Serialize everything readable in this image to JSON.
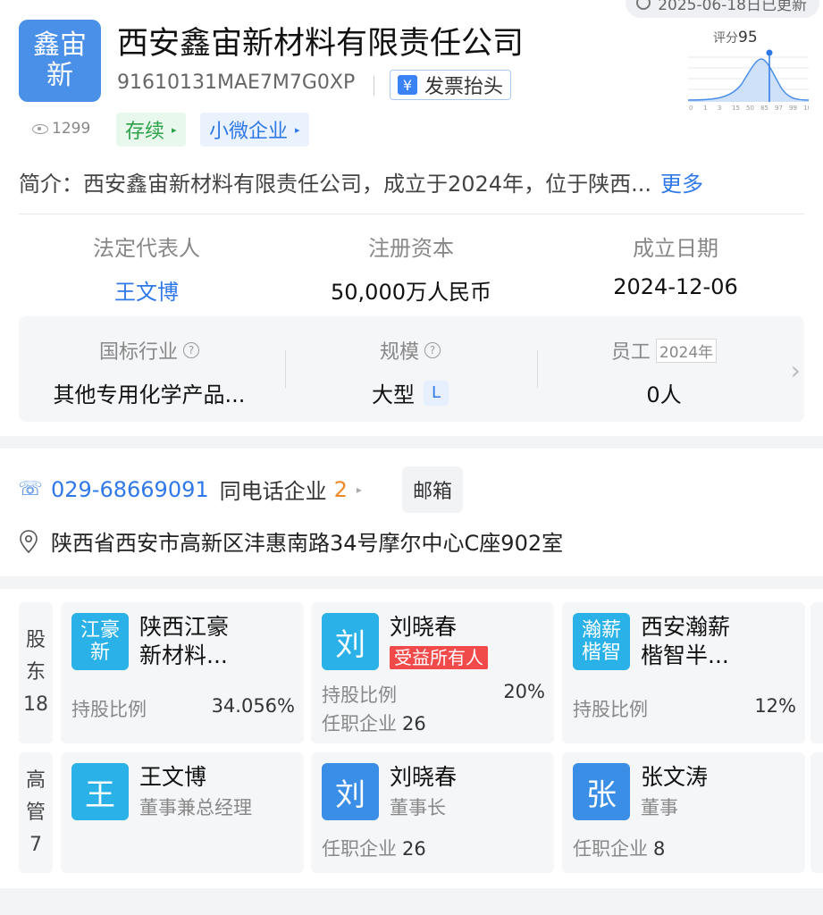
{
  "status": {
    "update_text": "2025-06-18日已更新"
  },
  "company": {
    "logo_lines": [
      "鑫宙",
      "新"
    ],
    "name": "西安鑫宙新材料有限责任公司",
    "credit_code": "91610131MAE7M7G0XP",
    "invoice_label": "发票抬头",
    "invoice_icon_glyph": "¥",
    "views": "1299",
    "tags": [
      {
        "label": "存续",
        "color": "#2ca14a"
      },
      {
        "label": "小微企业",
        "color": "#2f78e8"
      }
    ],
    "intro_prefix": "简介：",
    "intro_text": "西安鑫宙新材料有限责任公司，成立于2024年，位于陕西...",
    "intro_more": "更多"
  },
  "score": {
    "label": "评分",
    "value": "95",
    "ticks": [
      "0",
      "1",
      "3",
      "15",
      "50",
      "85",
      "97",
      "99",
      "100"
    ]
  },
  "key_info": [
    {
      "label": "法定代表人",
      "value": "王文博",
      "link": true
    },
    {
      "label": "注册资本",
      "value": "50,000万人民币",
      "link": false
    },
    {
      "label": "成立日期",
      "value": "2024-12-06",
      "link": false
    }
  ],
  "info_panel": {
    "industry": {
      "label": "国标行业",
      "value": "其他专用化学产品..."
    },
    "scale": {
      "label": "规模",
      "value": "大型",
      "badge": "L"
    },
    "staff": {
      "label": "员工",
      "year": "2024年",
      "value": "0人"
    }
  },
  "contact": {
    "phone": "029-68669091",
    "same_phone_label": "同电话企业",
    "same_phone_count": "2",
    "email_label": "邮箱",
    "address": "陕西省西安市高新区沣惠南路34号摩尔中心C座902室"
  },
  "shareholders": {
    "side_label": [
      "股",
      "东",
      "18"
    ],
    "items": [
      {
        "avatar_lines": [
          "江豪",
          "新"
        ],
        "avatar_color": "#29b1e8",
        "name_lines": [
          "陕西江豪",
          "新材料..."
        ],
        "ratio_label": "持股比例",
        "ratio": "34.056%"
      },
      {
        "avatar_lines": [
          "刘"
        ],
        "avatar_color": "#29b1e8",
        "name_lines": [
          "刘晓春"
        ],
        "badge": "受益所有人",
        "ratio_label": "持股比例",
        "ratio": "20%",
        "jobs_label": "任职企业",
        "jobs": "26"
      },
      {
        "avatar_lines": [
          "瀚薪",
          "楷智"
        ],
        "avatar_color": "#29b1e8",
        "name_lines": [
          "西安瀚薪",
          "楷智半..."
        ],
        "ratio_label": "持股比例",
        "ratio": "12%"
      }
    ]
  },
  "executives": {
    "side_label": [
      "高",
      "管",
      "7"
    ],
    "items": [
      {
        "avatar": "王",
        "avatar_color": "#29b1e8",
        "name": "王文博",
        "role": "董事兼总经理"
      },
      {
        "avatar": "刘",
        "avatar_color": "#3a8ee6",
        "name": "刘晓春",
        "role": "董事长",
        "jobs_label": "任职企业",
        "jobs": "26"
      },
      {
        "avatar": "张",
        "avatar_color": "#3a8ee6",
        "name": "张文涛",
        "role": "董事",
        "jobs_label": "任职企业",
        "jobs": "8"
      }
    ]
  }
}
